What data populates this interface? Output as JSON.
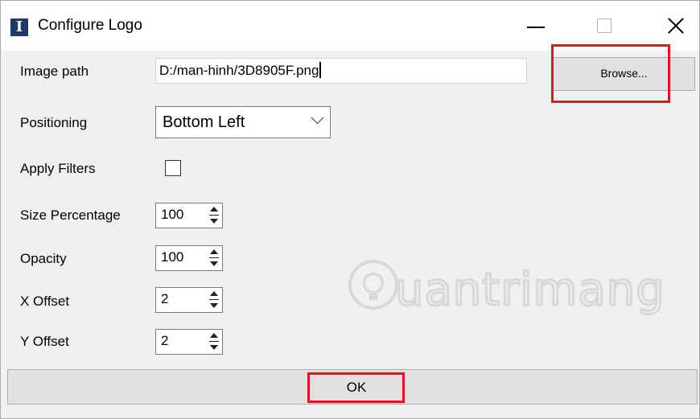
{
  "window": {
    "title": "Configure Logo",
    "app_icon_glyph": "I"
  },
  "form": {
    "image_path": {
      "label": "Image path",
      "value": "D:/man-hinh/3D8905F.png"
    },
    "browse_label": "Browse...",
    "positioning": {
      "label": "Positioning",
      "value": "Bottom Left"
    },
    "apply_filters": {
      "label": "Apply Filters",
      "checked": false
    },
    "size_percentage": {
      "label": "Size Percentage",
      "value": "100"
    },
    "opacity": {
      "label": "Opacity",
      "value": "100"
    },
    "x_offset": {
      "label": "X Offset",
      "value": "2"
    },
    "y_offset": {
      "label": "Y Offset",
      "value": "2"
    }
  },
  "ok_label": "OK",
  "colors": {
    "highlight": "#e8141d",
    "button_face": "#e1e1e1",
    "window_bg": "#f0f0f0"
  },
  "watermark": {
    "text": "uantrimang",
    "logo_icon": "lightbulb-circle-icon",
    "color": "#d8d8d8"
  }
}
